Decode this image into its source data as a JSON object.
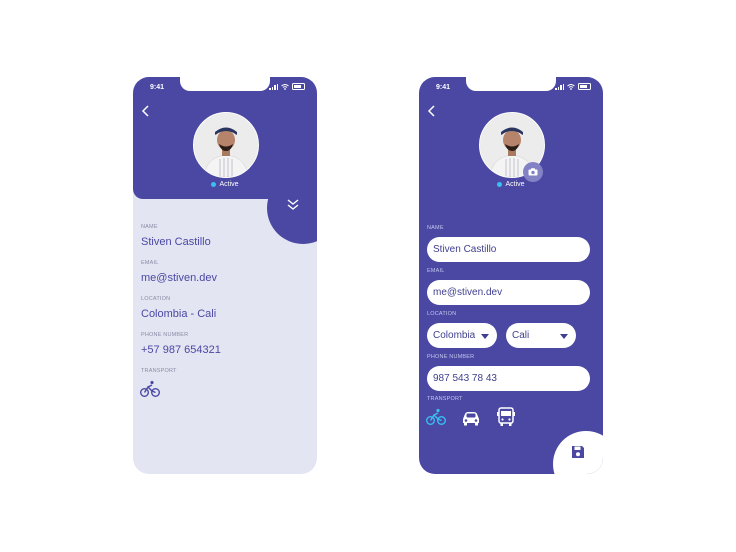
{
  "left_screen": {
    "status_time": "9:41",
    "active_label": "Active",
    "fields": {
      "name_label": "NAME",
      "name_value": "Stiven Castillo",
      "email_label": "EMAIL",
      "email_value": "me@stiven.dev",
      "location_label": "LOCATION",
      "location_value": "Colombia - Cali",
      "phone_label": "PHONE NUMBER",
      "phone_value": "+57 987 654321",
      "transport_label": "TRANSPORT"
    }
  },
  "right_screen": {
    "status_time": "9:41",
    "active_label": "Active",
    "fields": {
      "name_label": "NAME",
      "name_value": "Stiven Castillo",
      "email_label": "EMAIL",
      "email_value": "me@stiven.dev",
      "location_label": "LOCATION",
      "country_value": "Colombia",
      "city_value": "Cali",
      "phone_label": "PHONE NUMBER",
      "phone_value": "987 543 78 43",
      "transport_label": "TRANSPORT"
    },
    "transport_options": [
      "bicycle-icon",
      "car-icon",
      "bus-icon"
    ],
    "selected_transport": "bicycle-icon"
  },
  "colors": {
    "primary": "#4a48a3",
    "accent": "#38c1f0",
    "light_bg": "#e3e5f3"
  }
}
